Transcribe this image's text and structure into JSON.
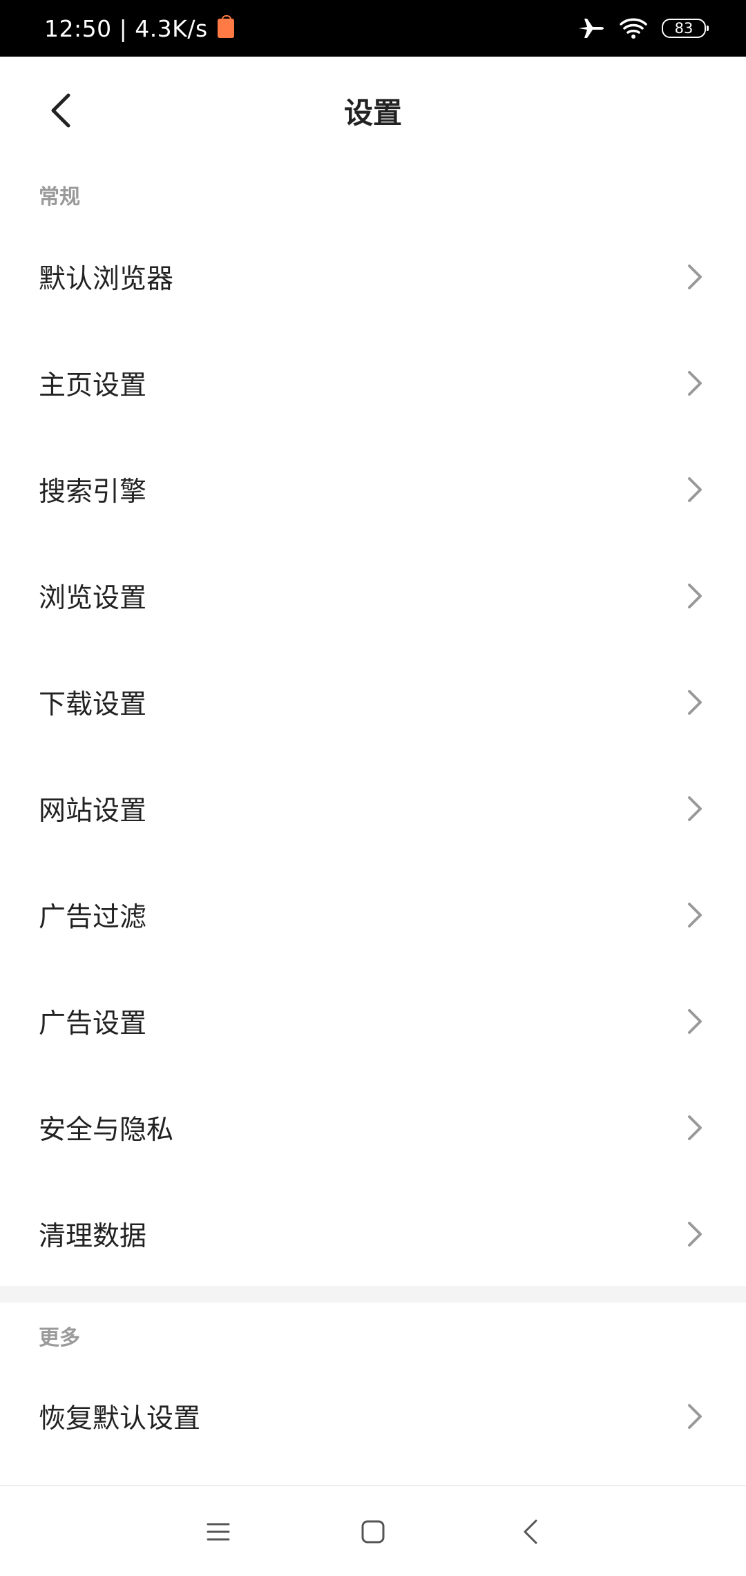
{
  "status_bar": {
    "time_speed": "12:50 | 4.3K/s",
    "battery": "83"
  },
  "header": {
    "title": "设置"
  },
  "sections": [
    {
      "header": "常规",
      "items": [
        {
          "label": "默认浏览器"
        },
        {
          "label": "主页设置"
        },
        {
          "label": "搜索引擎"
        },
        {
          "label": "浏览设置"
        },
        {
          "label": "下载设置"
        },
        {
          "label": "网站设置"
        },
        {
          "label": "广告过滤"
        },
        {
          "label": "广告设置"
        },
        {
          "label": "安全与隐私"
        },
        {
          "label": "清理数据"
        }
      ]
    },
    {
      "header": "更多",
      "items": [
        {
          "label": "恢复默认设置"
        }
      ]
    }
  ],
  "icons": {
    "back": "chevron-left-icon",
    "row_arrow": "chevron-right-icon",
    "nav_menu": "menu-icon",
    "nav_home": "square-home-icon",
    "nav_back": "back-triangle-icon"
  },
  "colors": {
    "text_primary": "#222222",
    "section_header": "#9a9a9a",
    "chevron": "#999999",
    "accent_shop": "#ff7a45"
  }
}
